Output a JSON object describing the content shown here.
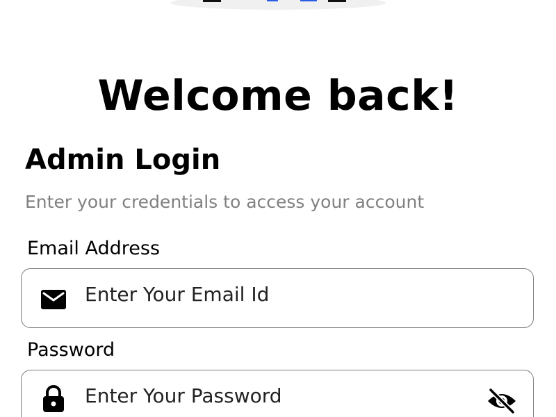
{
  "header": {
    "welcome_title": "Welcome back!"
  },
  "login": {
    "heading": "Admin Login",
    "subtitle": "Enter your credentials to access your account"
  },
  "email": {
    "label": "Email Address",
    "placeholder": "Enter Your Email Id",
    "value": "",
    "icon": "mail-icon"
  },
  "password": {
    "label": "Password",
    "placeholder": "Enter Your Password",
    "value": "",
    "icon": "lock-icon",
    "visibility_icon": "eye-off-icon"
  },
  "colors": {
    "text": "#000000",
    "subtitle": "#808080",
    "border": "#7a7a7a",
    "illustration_accent": "#2b5ce6"
  }
}
